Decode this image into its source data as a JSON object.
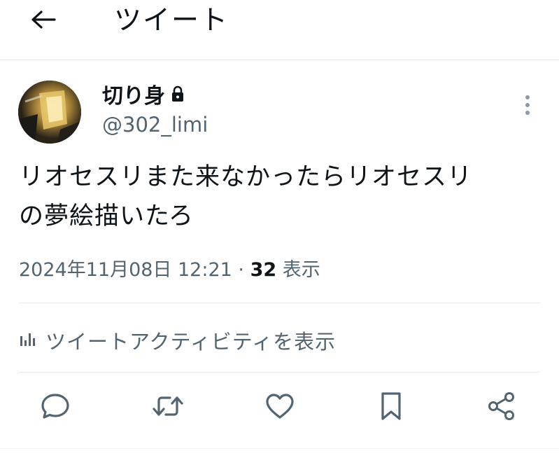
{
  "header": {
    "title": "ツイート",
    "back_icon": "arrow-left-icon"
  },
  "author": {
    "display_name": "切り身",
    "handle": "@302_limi",
    "protected_icon": "lock-icon"
  },
  "tweet": {
    "text": "リオセスリまた来なかったらリオセスリ\nの夢絵描いたろ",
    "timestamp": "2024年11月08日 12:21",
    "separator": " · ",
    "views_count": "32",
    "views_label": " 表示"
  },
  "activity": {
    "label": "ツイートアクティビティを表示",
    "icon": "bar-chart-icon"
  },
  "actions": {
    "reply_icon": "reply-icon",
    "retweet_icon": "retweet-icon",
    "like_icon": "heart-icon",
    "bookmark_icon": "bookmark-icon",
    "share_icon": "share-icon"
  },
  "colors": {
    "text_primary": "#0f1419",
    "text_secondary": "#536471",
    "divider": "#e7e9ea"
  }
}
